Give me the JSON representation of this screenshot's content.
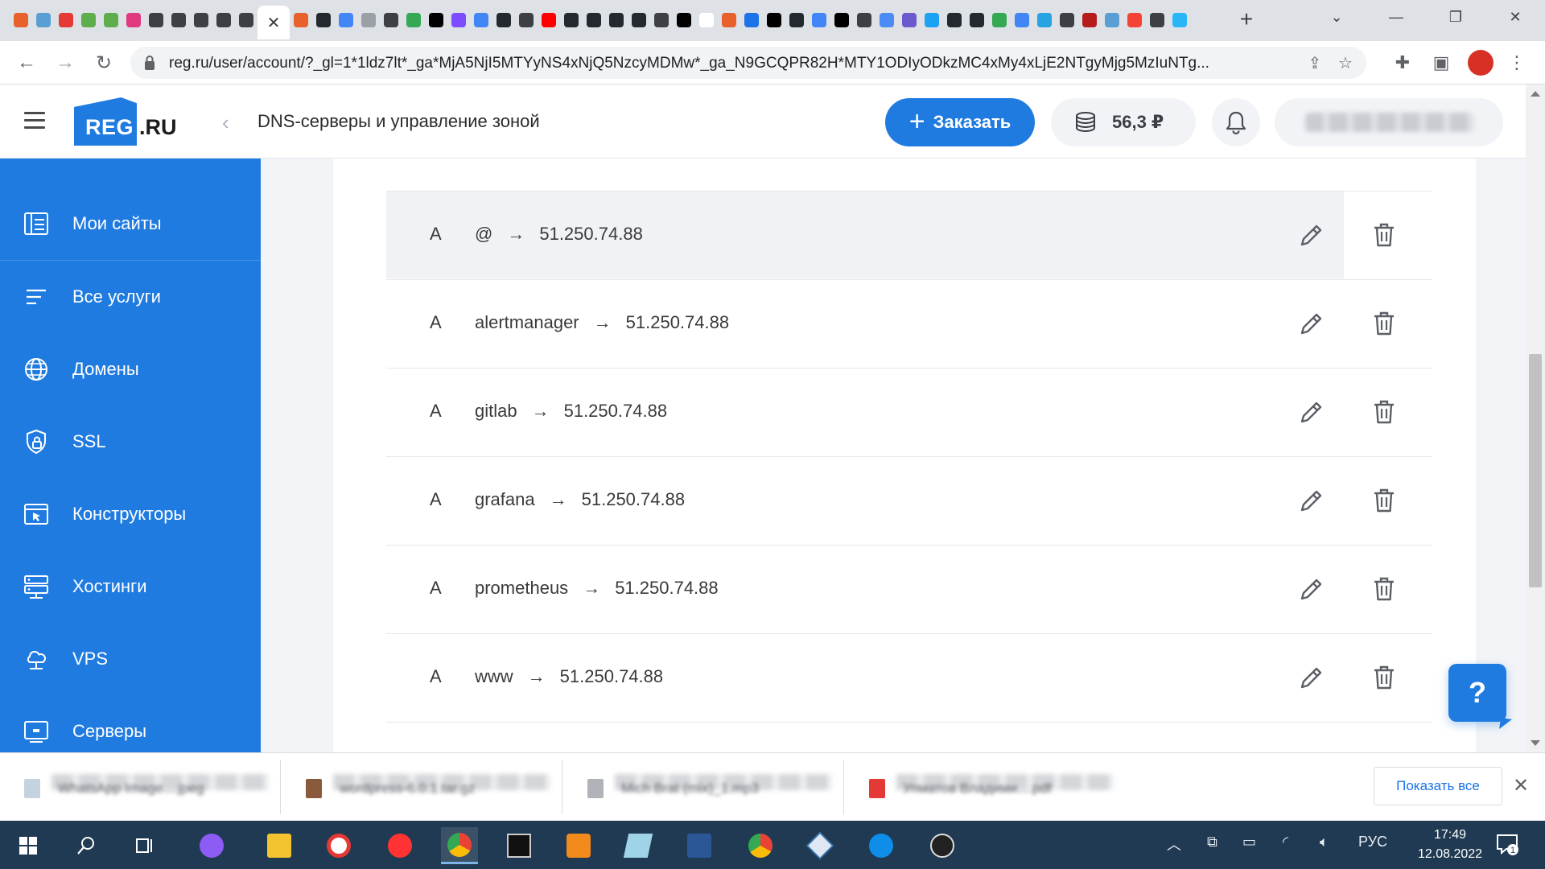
{
  "browser": {
    "active_tab_close": "✕",
    "new_tab": "+",
    "url": "reg.ru/user/account/?_gl=1*1ldz7lt*_ga*MjA5NjI5MTYyNS4xNjQ5NzcyMDMw*_ga_N9GCQPR82H*MTY1ODIyODkzMC4xMy4xLjE2NTgyMjg5MzIuNTg...",
    "tab_favicon_colors": [
      "#e8612c",
      "#5a9fd4",
      "#e53935",
      "#5fae4e",
      "#5fae4e",
      "#e0397d",
      "#3c4043",
      "#3c4043",
      "#3c4043",
      "#3c4043",
      "#3c4043",
      "#e8612c",
      "#24292f",
      "#4285f4",
      "#9aa0a6",
      "#3c4043",
      "#34a853",
      "#000000",
      "#7b4dff",
      "#4285f4",
      "#24292f",
      "#3c4043",
      "#ff0000",
      "#24292f",
      "#24292f",
      "#24292f",
      "#24292f",
      "#3c4043",
      "#000000",
      "#ffffff",
      "#e8612c",
      "#1a73e8",
      "#000000",
      "#24292f",
      "#4285f4",
      "#000000",
      "#3c4043",
      "#4c8bf5",
      "#6a5acd",
      "#1da1f2",
      "#24292f",
      "#24292f",
      "#34a853",
      "#4285f4",
      "#27a2e3",
      "#3c4043",
      "#b71c1c",
      "#5a9fd4",
      "#f44336",
      "#3c4043",
      "#29b6f6"
    ]
  },
  "header": {
    "logo_reg": "REG",
    "logo_ru": ".RU",
    "back": "‹",
    "page_title": "DNS-серверы и управление зоной",
    "order_label": "Заказать",
    "order_plus": "+",
    "balance": "56,3 ₽"
  },
  "sidebar": {
    "items": [
      {
        "label": "Мои сайты",
        "icon": "sites-icon"
      },
      {
        "label": "Все услуги",
        "icon": "services-icon"
      },
      {
        "label": "Домены",
        "icon": "globe-icon"
      },
      {
        "label": "SSL",
        "icon": "ssl-lock-icon"
      },
      {
        "label": "Конструкторы",
        "icon": "builder-icon"
      },
      {
        "label": "Хостинги",
        "icon": "hosting-icon"
      },
      {
        "label": "VPS",
        "icon": "vps-icon"
      },
      {
        "label": "Серверы",
        "icon": "servers-icon"
      }
    ]
  },
  "dns": {
    "arrow": "→",
    "records": [
      {
        "type": "A",
        "name": "@",
        "value": "51.250.74.88"
      },
      {
        "type": "A",
        "name": "alertmanager",
        "value": "51.250.74.88"
      },
      {
        "type": "A",
        "name": "gitlab",
        "value": "51.250.74.88"
      },
      {
        "type": "A",
        "name": "grafana",
        "value": "51.250.74.88"
      },
      {
        "type": "A",
        "name": "prometheus",
        "value": "51.250.74.88"
      },
      {
        "type": "A",
        "name": "www",
        "value": "51.250.74.88"
      }
    ]
  },
  "help": "?",
  "downloads": {
    "items": [
      {
        "name": "WhatsApp Image....jpeg",
        "color": "#c5d3e0"
      },
      {
        "name": "wordpress-6.0.1.tar.gz",
        "color": "#8a5a3c"
      },
      {
        "name": "Mich Brat (mix)_1.mp3",
        "color": "#b0b4b8"
      },
      {
        "name": "Упматов Владими....pdf",
        "color": "#e53935"
      }
    ],
    "show_all": "Показать все",
    "close": "✕"
  },
  "taskbar": {
    "lang": "РУС",
    "time": "17:49",
    "date": "12.08.2022",
    "notifications": "1"
  }
}
